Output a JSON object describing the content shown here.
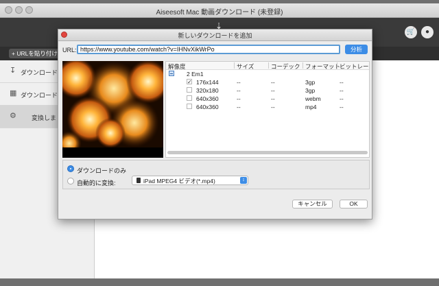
{
  "app": {
    "title": "Aiseesoft Mac 動画ダウンロード (未登録)",
    "add_url_button": "+ URLを貼り付け"
  },
  "sidebar": {
    "items": [
      {
        "label": "ダウンロードし",
        "icon": "download-icon"
      },
      {
        "label": "ダウンロードし",
        "icon": "downloaded-list-icon"
      },
      {
        "label": "変換しまし",
        "icon": "convert-gear-icon"
      }
    ]
  },
  "dialog": {
    "title": "新しいダウンロードを追加",
    "url_label": "URL:",
    "url_value": "https://www.youtube.com/watch?v=IHNvXikWrPo",
    "analyze_button": "分析",
    "columns": [
      "解像度",
      "サイズ",
      "コーデック",
      "フォーマット",
      "ビットレー"
    ],
    "group_label": "2 Em1",
    "rows": [
      {
        "resolution": "176x144",
        "size": "--",
        "codec": "--",
        "format": "3gp",
        "bitrate": "--",
        "checked": true
      },
      {
        "resolution": "320x180",
        "size": "--",
        "codec": "--",
        "format": "3gp",
        "bitrate": "--",
        "checked": false
      },
      {
        "resolution": "640x360",
        "size": "--",
        "codec": "--",
        "format": "webm",
        "bitrate": "--",
        "checked": false
      },
      {
        "resolution": "640x360",
        "size": "--",
        "codec": "--",
        "format": "mp4",
        "bitrate": "--",
        "checked": false
      }
    ],
    "option_download_only": "ダウンロードのみ",
    "option_auto_convert": "自動的に変換:",
    "format_select_value": "iPad MPEG4 ビデオ(*.mp4)",
    "cancel_button": "キャンセル",
    "ok_button": "OK"
  },
  "colors": {
    "accent": "#3d8de6",
    "toolbar": "#3a3a3a",
    "close_button": "#e2463f"
  }
}
